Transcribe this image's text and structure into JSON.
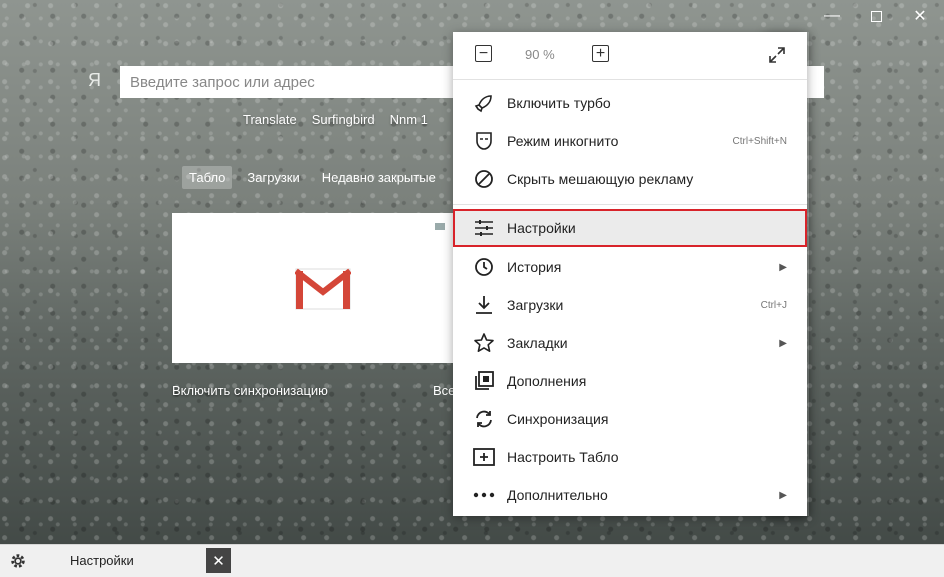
{
  "window": {
    "menu_glyph": "≡",
    "minimize_glyph": "—",
    "close_glyph": "✕"
  },
  "search": {
    "logo": "Я",
    "placeholder": "Введите запрос или адрес"
  },
  "shortcuts": [
    "Translate",
    "Surfingbird",
    "Nnm 1"
  ],
  "tabs": [
    "Табло",
    "Загрузки",
    "Недавно закрытые"
  ],
  "sync_text": "Включить синхронизацию",
  "sync_right_text": "Все",
  "menu": {
    "zoom_value": "90 %",
    "zoom_minus": "−",
    "zoom_plus": "+",
    "items": [
      {
        "label": "Включить турбо",
        "icon": "rocket-icon"
      },
      {
        "label": "Режим инкогнито",
        "icon": "incognito-icon",
        "shortcut": "Ctrl+Shift+N"
      },
      {
        "label": "Скрыть мешающую рекламу",
        "icon": "block-icon"
      },
      {
        "label": "Настройки",
        "icon": "settings-sliders-icon"
      },
      {
        "label": "История",
        "icon": "clock-icon",
        "arrow": "▶"
      },
      {
        "label": "Загрузки",
        "icon": "download-icon",
        "shortcut": "Ctrl+J"
      },
      {
        "label": "Закладки",
        "icon": "star-icon",
        "arrow": "▶"
      },
      {
        "label": "Дополнения",
        "icon": "extensions-icon"
      },
      {
        "label": "Синхронизация",
        "icon": "sync-icon"
      },
      {
        "label": "Настроить Табло",
        "icon": "add-tile-icon"
      },
      {
        "label": "Дополнительно",
        "icon": "more-icon",
        "arrow": "▶"
      }
    ]
  },
  "bottombar": {
    "label": "Настройки",
    "close_glyph": "✕"
  },
  "colors": {
    "highlight_border": "#d8232a",
    "gmail_red": "#d44638"
  }
}
